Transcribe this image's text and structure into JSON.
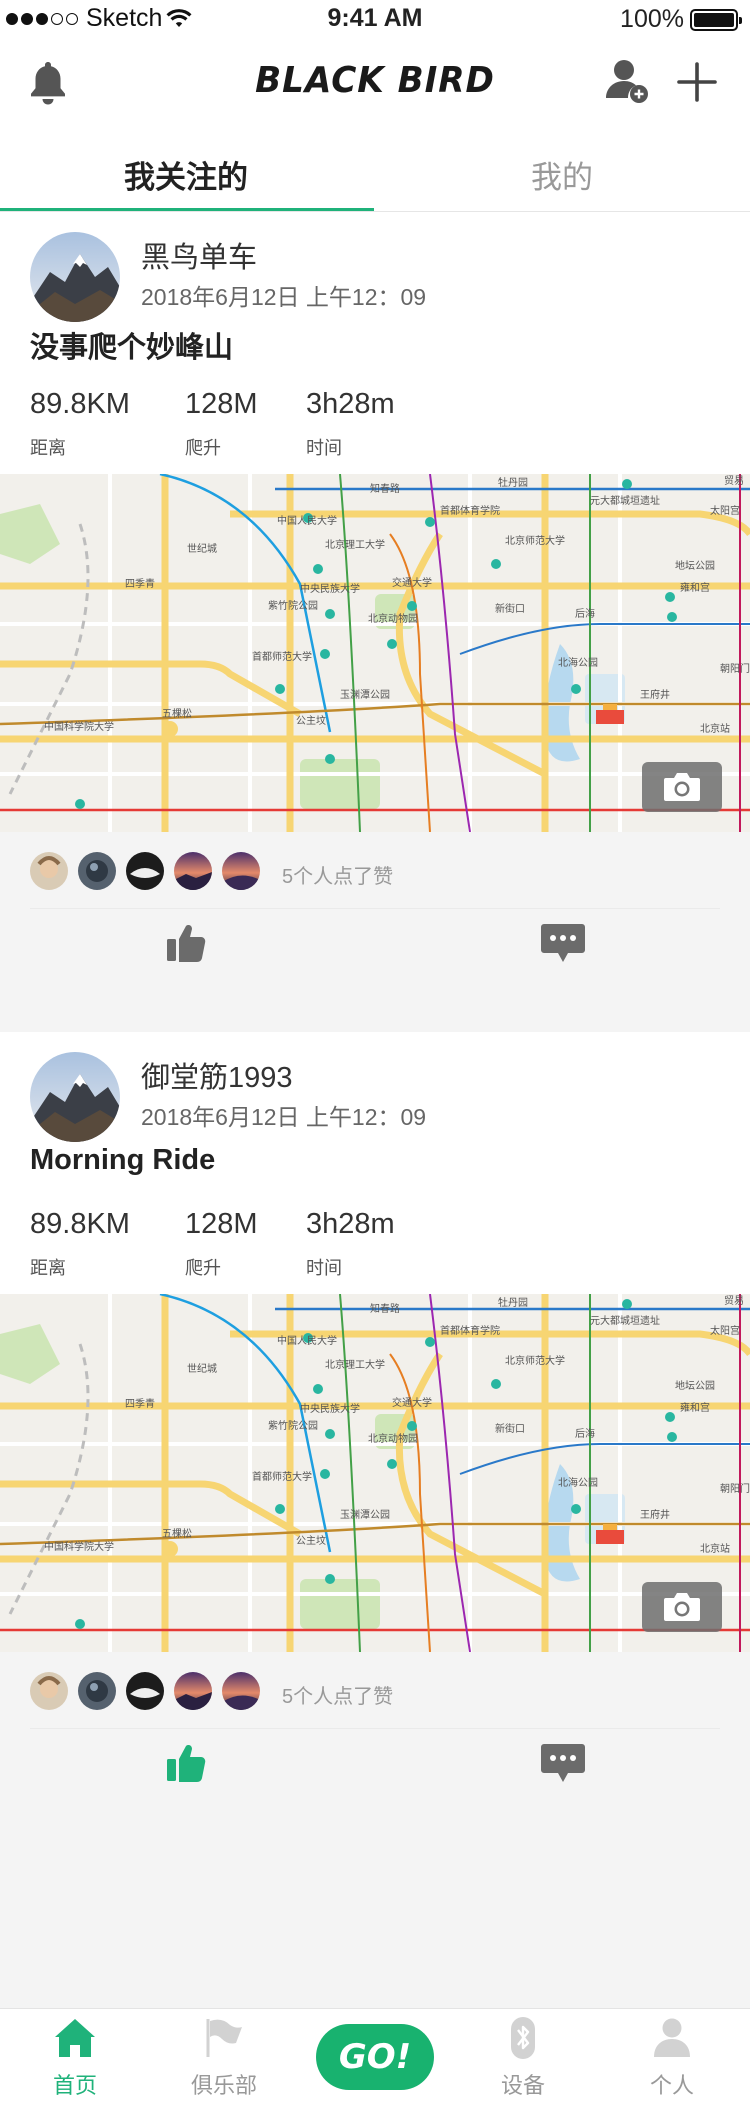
{
  "status_bar": {
    "carrier": "Sketch",
    "time": "9:41 AM",
    "battery": "100%"
  },
  "header": {
    "logo": "BLACK BIRD"
  },
  "tabs": [
    {
      "label": "我关注的",
      "active": true
    },
    {
      "label": "我的",
      "active": false
    }
  ],
  "posts": [
    {
      "username": "黑鸟单车",
      "datetime": "2018年6月12日 上午12：09",
      "title": "没事爬个妙峰山",
      "stats": [
        {
          "value": "89.8KM",
          "label": "距离"
        },
        {
          "value": "128M",
          "label": "爬升"
        },
        {
          "value": "3h28m",
          "label": "时间"
        }
      ],
      "likes_text": "5个人点了赞",
      "liked": false
    },
    {
      "username": "御堂筋1993",
      "datetime": "2018年6月12日 上午12：09",
      "title": "Morning Ride",
      "stats": [
        {
          "value": "89.8KM",
          "label": "距离"
        },
        {
          "value": "128M",
          "label": "爬升"
        },
        {
          "value": "3h28m",
          "label": "时间"
        }
      ],
      "likes_text": "5个人点了赞",
      "liked": true
    }
  ],
  "map_labels": [
    "牡丹园",
    "知春路",
    "中国人民大学",
    "首都体育学院",
    "元大都城垣遗址",
    "太阳宫",
    "世纪城",
    "北京理工大学",
    "北京师范大学",
    "四季青",
    "中央民族大学",
    "交通大学",
    "地坛公园",
    "雍和宫",
    "紫竹院公园",
    "北京动物园",
    "新街口",
    "后海",
    "首都师范大学",
    "北海公园",
    "朝阳门",
    "玉渊潭公园",
    "五棵松",
    "公主坟",
    "王府井",
    "北京站",
    "中国科学院大学",
    "贸易"
  ],
  "nav": [
    {
      "label": "首页",
      "icon": "home-icon",
      "active": true
    },
    {
      "label": "俱乐部",
      "icon": "flag-icon",
      "active": false
    },
    {
      "label": "GO!",
      "icon": "go-button",
      "active": false
    },
    {
      "label": "设备",
      "icon": "bluetooth-icon",
      "active": false
    },
    {
      "label": "个人",
      "icon": "person-icon",
      "active": false
    }
  ],
  "colors": {
    "accent": "#1fb27a",
    "go": "#18b26f",
    "muted": "#999999",
    "icon": "#6b6b6b"
  }
}
